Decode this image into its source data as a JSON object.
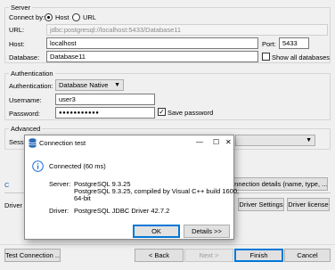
{
  "server": {
    "group_title": "Server",
    "connect_by_label": "Connect by:",
    "host_radio_label": "Host",
    "url_radio_label": "URL",
    "url_label": "URL:",
    "url_value": "jdbc:postgresql://localhost:5433/Database11",
    "host_label": "Host:",
    "host_value": "localhost",
    "port_label": "Port:",
    "port_value": "5433",
    "database_label": "Database:",
    "database_value": "Database11",
    "show_all_databases_label": "Show all databases"
  },
  "auth": {
    "group_title": "Authentication",
    "authentication_label": "Authentication:",
    "authentication_value": "Database Native",
    "username_label": "Username:",
    "username_value": "user3",
    "password_label": "Password:",
    "password_value": "●●●●●●●●●●●",
    "save_password_label": "Save password"
  },
  "advanced": {
    "group_title": "Advanced",
    "session_label": "Sessi"
  },
  "links": {
    "connection_details_button": "onnection details (name, type, ... )"
  },
  "driver": {
    "driver_label": "Driver",
    "driver_settings_button": "Driver Settings",
    "driver_license_button": "Driver license"
  },
  "dialog": {
    "title": "Connection test",
    "minimize_glyph": "—",
    "maximize_glyph": "☐",
    "close_glyph": "✕",
    "status_text": "Connected (60 ms)",
    "server_label": "Server:",
    "server_line1": "PostgreSQL 9.3.25",
    "server_line2": "PostgreSQL 9.3.25, compiled by Visual C++ build 1600,",
    "server_line3": "64-bit",
    "driver_label": "Driver:",
    "driver_value": "PostgreSQL JDBC Driver 42.7.2",
    "ok_button": "OK",
    "details_button": "Details >>"
  },
  "footer": {
    "test_connection_button": "Test Connection ...",
    "back_button": "< Back",
    "next_button": "Next >",
    "finish_button": "Finish",
    "cancel_button": "Cancel"
  },
  "colors": {
    "info_icon": "#1e6fd9",
    "primary_border": "#0078d7"
  }
}
